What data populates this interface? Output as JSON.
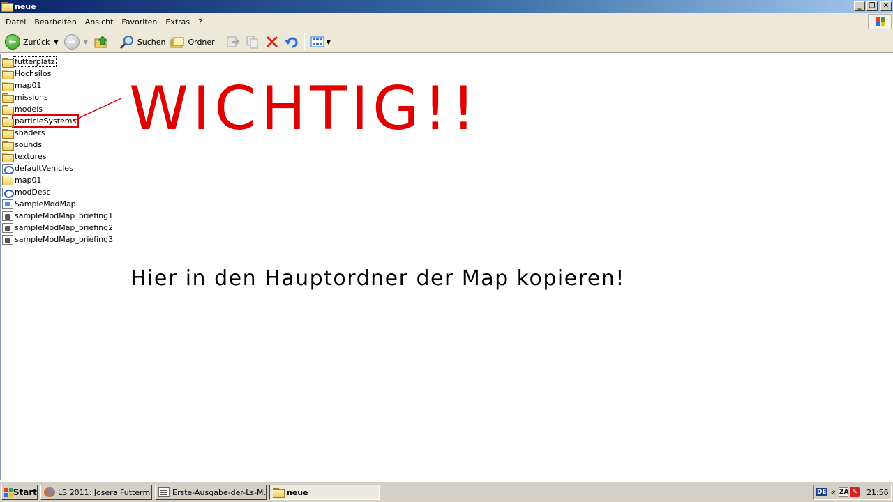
{
  "window": {
    "title": "neue"
  },
  "menubar": {
    "items": [
      "Datei",
      "Bearbeiten",
      "Ansicht",
      "Favoriten",
      "Extras",
      "?"
    ]
  },
  "toolbar": {
    "back_label": "Zurück",
    "search_label": "Suchen",
    "folders_label": "Ordner"
  },
  "files": [
    {
      "name": "futterplatz",
      "type": "folder"
    },
    {
      "name": "Hochsilos",
      "type": "folder"
    },
    {
      "name": "map01",
      "type": "folder"
    },
    {
      "name": "missions",
      "type": "folder"
    },
    {
      "name": "models",
      "type": "folder"
    },
    {
      "name": "particleSystems",
      "type": "folder"
    },
    {
      "name": "shaders",
      "type": "folder"
    },
    {
      "name": "sounds",
      "type": "folder"
    },
    {
      "name": "textures",
      "type": "folder"
    },
    {
      "name": "defaultVehicles",
      "type": "xml"
    },
    {
      "name": "map01",
      "type": "i3d"
    },
    {
      "name": "modDesc",
      "type": "xml"
    },
    {
      "name": "SampleModMap",
      "type": "lua"
    },
    {
      "name": "sampleModMap_briefing1",
      "type": "image"
    },
    {
      "name": "sampleModMap_briefing2",
      "type": "image"
    },
    {
      "name": "sampleModMap_briefing3",
      "type": "image"
    }
  ],
  "annotations": {
    "big": "WICHTIG!!",
    "small": "Hier in den Hauptordner der Map kopieren!",
    "color": "#e00000"
  },
  "taskbar": {
    "start_label": "Start",
    "tasks": [
      {
        "label": "LS 2011: Josera Futtermi..."
      },
      {
        "label": "Erste-Ausgabe-der-Ls-M..."
      },
      {
        "label": "neue"
      }
    ],
    "lang": "DE",
    "chevron": "«",
    "tray_za": "ZA",
    "clock": "21:56"
  }
}
